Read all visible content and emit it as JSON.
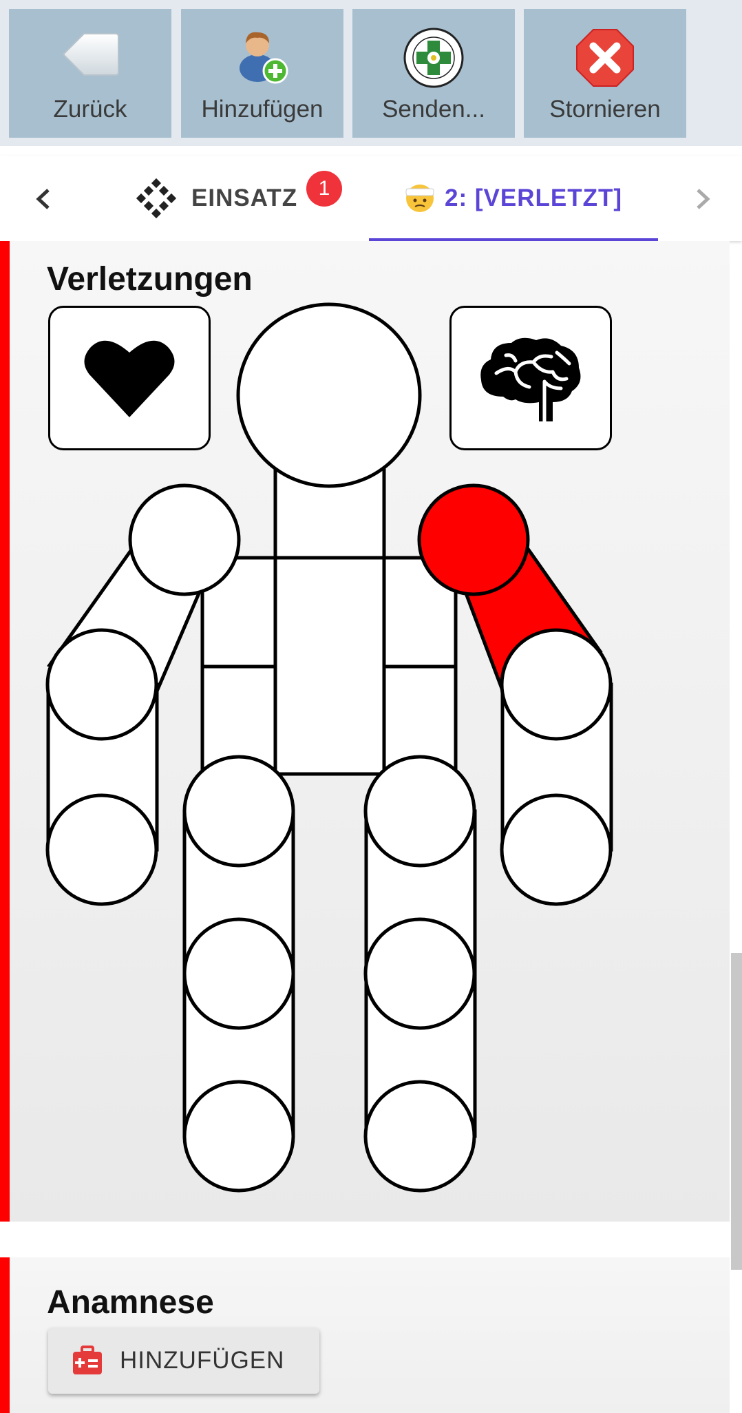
{
  "toolbar": {
    "back_label": "Zurück",
    "add_label": "Hinzufügen",
    "send_label": "Senden...",
    "cancel_label": "Stornieren",
    "icons": {
      "back": "back-arrow-icon",
      "add": "add-person-icon",
      "send": "bergrettung-emblem-icon",
      "cancel": "red-x-icon"
    }
  },
  "tabs": {
    "einsatz_label": "EINSATZ",
    "einsatz_badge": "1",
    "verletzt_label": "2: [VERLETZT]",
    "active_color": "#5a45d6"
  },
  "injuries": {
    "title": "Verletzungen",
    "highlight_color": "#ff0000",
    "selected_part": "left-shoulder-upper-arm"
  },
  "anamnese": {
    "title": "Anamnese",
    "add_label": "HINZUFÜGEN"
  },
  "accent_colors": {
    "card_border": "#ff0000",
    "toolbar_button": "#a7bfcf"
  }
}
